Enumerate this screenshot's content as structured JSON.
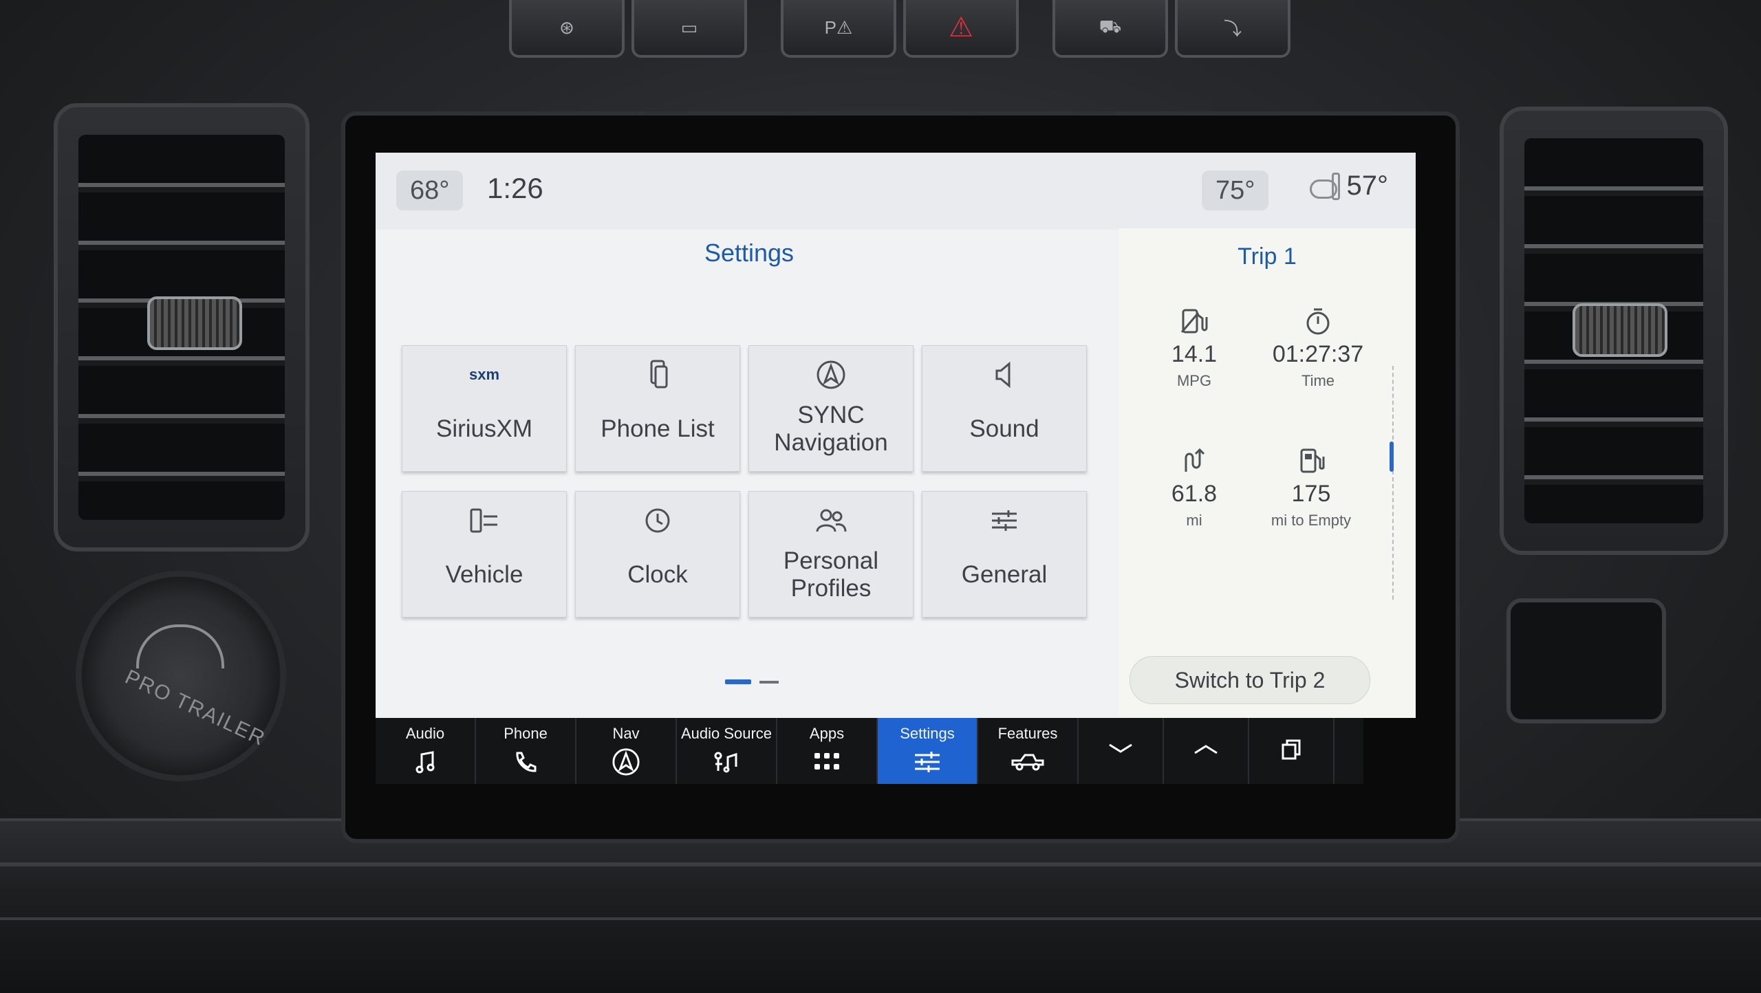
{
  "status_bar": {
    "driver_temp": "68°",
    "time": "1:26",
    "passenger_temp": "75°",
    "outside_temp": "57°"
  },
  "settings": {
    "title": "Settings",
    "tiles": [
      {
        "label": "SiriusXM",
        "icon": "siriusxm-icon",
        "icon_text": "sxm"
      },
      {
        "label": "Phone List",
        "icon": "phone-list-icon"
      },
      {
        "label": "SYNC\nNavigation",
        "icon": "navigation-icon"
      },
      {
        "label": "Sound",
        "icon": "speaker-icon"
      },
      {
        "label": "Vehicle",
        "icon": "vehicle-settings-icon"
      },
      {
        "label": "Clock",
        "icon": "clock-icon"
      },
      {
        "label": "Personal\nProfiles",
        "icon": "profiles-icon"
      },
      {
        "label": "General",
        "icon": "sliders-icon"
      }
    ]
  },
  "trip": {
    "title": "Trip 1",
    "mpg_value": "14.1",
    "mpg_unit": "MPG",
    "time_value": "01:27:37",
    "time_unit": "Time",
    "distance_value": "61.8",
    "distance_unit": "mi",
    "range_value": "175",
    "range_unit": "mi to Empty",
    "switch_label": "Switch to Trip 2"
  },
  "nav": {
    "items": [
      {
        "label": "Audio",
        "icon": "music-note-icon"
      },
      {
        "label": "Phone",
        "icon": "phone-icon"
      },
      {
        "label": "Nav",
        "icon": "nav-arrow-icon"
      },
      {
        "label": "Audio Source",
        "icon": "audio-source-icon"
      },
      {
        "label": "Apps",
        "icon": "apps-grid-icon"
      },
      {
        "label": "Settings",
        "icon": "settings-sliders-icon",
        "active": true
      },
      {
        "label": "Features",
        "icon": "truck-icon"
      }
    ],
    "active_color": "#1e63d0"
  },
  "hardware": {
    "hazard_color": "#d8323a",
    "dial_label": "PRO TRAILER"
  }
}
